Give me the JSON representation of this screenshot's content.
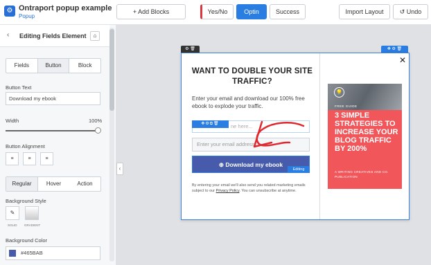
{
  "header": {
    "app_title": "Ontraport popup example",
    "app_subtitle": "Popup",
    "add_blocks": "+ Add Blocks",
    "tab_yesno": "Yes/No",
    "tab_optin": "Optin",
    "tab_success": "Success",
    "import_layout": "Import Layout",
    "undo": "Undo"
  },
  "sidebar": {
    "title": "Editing Fields Element",
    "tabs": [
      "Fields",
      "Button",
      "Block"
    ],
    "button_text_label": "Button Text",
    "button_text_value": "Download my ebook",
    "width_label": "Width",
    "width_value": "100%",
    "alignment_label": "Button Alignment",
    "state_tabs": [
      "Regular",
      "Hover",
      "Action"
    ],
    "bg_style_label": "Background Style",
    "bg_solid": "SOLID",
    "bg_gradient": "GRADIENT",
    "bg_color_label": "Background Color",
    "bg_color_value": "#465BAB"
  },
  "popup": {
    "headline": "WANT TO DOUBLE YOUR SITE TRAFFIC?",
    "body": "Enter your email and download our 100% free ebook to explode your traffic.",
    "name_placeholder": "ne here...",
    "email_placeholder": "Enter your email address",
    "button_label": "Download my ebook",
    "editing_badge": "Editing",
    "disclaimer_pre": "By entering your email we'll also send you related marketing emails subject to our ",
    "disclaimer_link": "Privacy Policy",
    "disclaimer_post": ". You can unsubscribe at anytime.",
    "book_guide": "FREE GUIDE",
    "book_title": "3 SIMPLE STRATEGIES TO INCREASE YOUR BLOG TRAFFIC BY 200%",
    "book_sub": "A WRITING CREATIVES AND CO. PUBLICATION"
  },
  "colors": {
    "accent": "#2a7de1",
    "button": "#465BAB",
    "book": "#f0565a"
  }
}
